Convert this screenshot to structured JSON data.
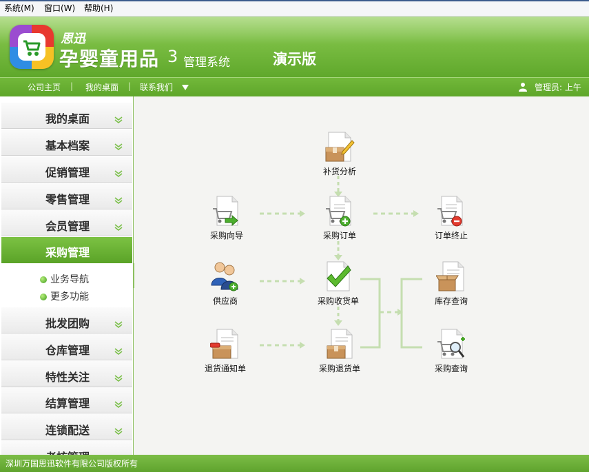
{
  "menu": {
    "items": [
      "系统(M)",
      "窗口(W)",
      "帮助(H)"
    ]
  },
  "header": {
    "brand_small": "思迅",
    "brand_big": "孕婴童用品",
    "brand_num": "3",
    "brand_sys": "管理系统",
    "edition": "演示版"
  },
  "nav": {
    "links": [
      "公司主页",
      "我的桌面",
      "联系我们"
    ],
    "separator": "|",
    "user_text": "管理员:  上午"
  },
  "sidebar": {
    "items_top": [
      "我的桌面",
      "基本档案",
      "促销管理",
      "零售管理",
      "会员管理"
    ],
    "active": "采购管理",
    "sub_items": [
      "业务导航",
      "更多功能"
    ],
    "items_bottom": [
      "批发团购",
      "仓库管理",
      "特性关注",
      "结算管理",
      "连锁配送",
      "考核管理"
    ]
  },
  "flow": {
    "nodes": [
      {
        "label": "补货分析",
        "icon": "box-pencil-icon"
      },
      {
        "label": "采购向导",
        "icon": "cart-arrow-icon"
      },
      {
        "label": "采购订单",
        "icon": "cart-plus-icon"
      },
      {
        "label": "订单终止",
        "icon": "cart-minus-icon"
      },
      {
        "label": "供应商",
        "icon": "users-icon"
      },
      {
        "label": "采购收货单",
        "icon": "checkmark-doc-icon"
      },
      {
        "label": "库存查询",
        "icon": "open-box-icon"
      },
      {
        "label": "退货通知单",
        "icon": "box-minus-icon"
      },
      {
        "label": "采购退货单",
        "icon": "box-doc-icon"
      },
      {
        "label": "采购查询",
        "icon": "cart-search-icon"
      }
    ]
  },
  "footer": {
    "copyright": "深圳万国思迅软件有限公司版权所有"
  },
  "colors": {
    "brand_green": "#6cb335",
    "arrow": "#c5deb0"
  }
}
